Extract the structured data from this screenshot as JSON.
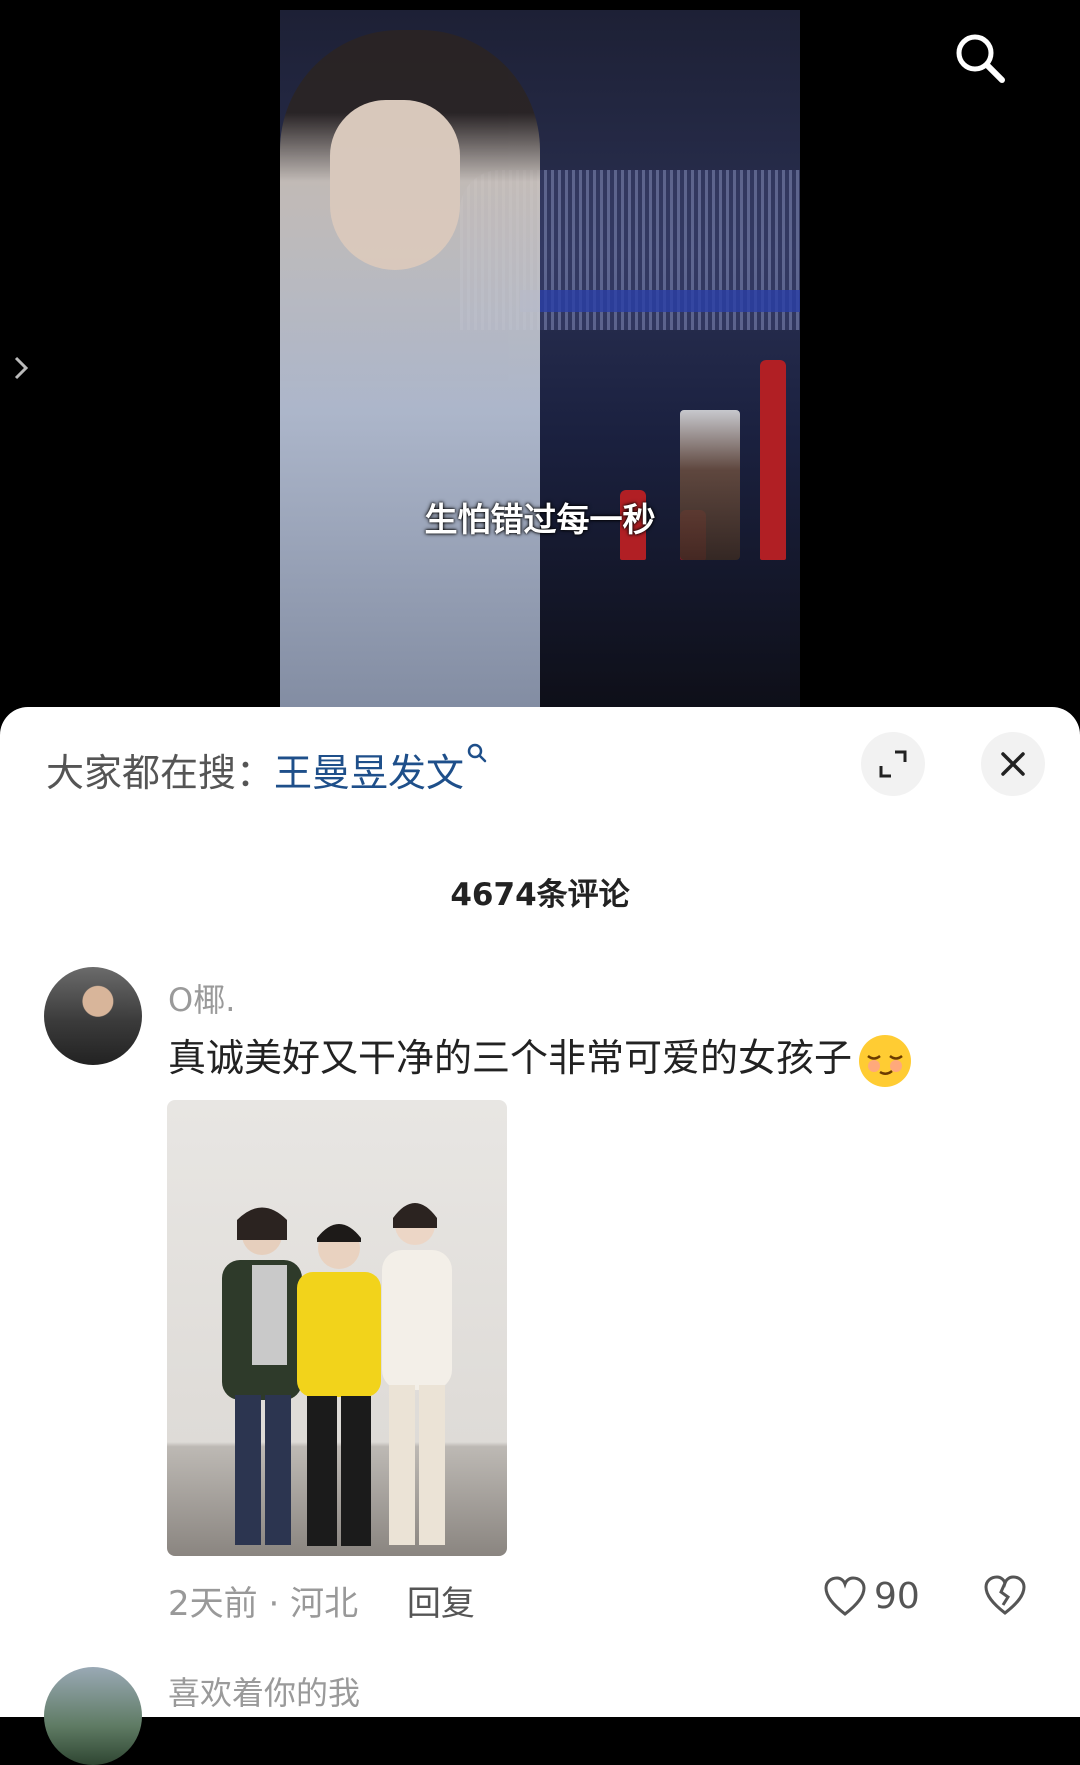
{
  "video": {
    "caption": "生怕错过每一秒"
  },
  "sheet": {
    "trending_prefix": "大家都在搜：",
    "trending_keyword": "王曼昱发文",
    "comment_count_label": "4674条评论"
  },
  "comments": [
    {
      "username": "O椰.",
      "text": "真诚美好又干净的三个非常可爱的女孩子",
      "time": "2天前",
      "separator": "·",
      "location": "河北",
      "reply_label": "回复",
      "like_count": "90",
      "has_image": true
    },
    {
      "username": "喜欢着你的我"
    }
  ],
  "icons": {
    "video_search": "search-icon",
    "side_arrow": "chevron-right-icon",
    "keyword_search": "search-icon",
    "expand": "expand-icon",
    "close": "close-icon",
    "emoji": "smiling-emoji-icon",
    "like": "heart-outline-icon",
    "dislike": "broken-heart-icon"
  },
  "colors": {
    "keyword": "#1e4f8a",
    "sheet_bg": "#ffffff",
    "video_bg": "#000000"
  }
}
